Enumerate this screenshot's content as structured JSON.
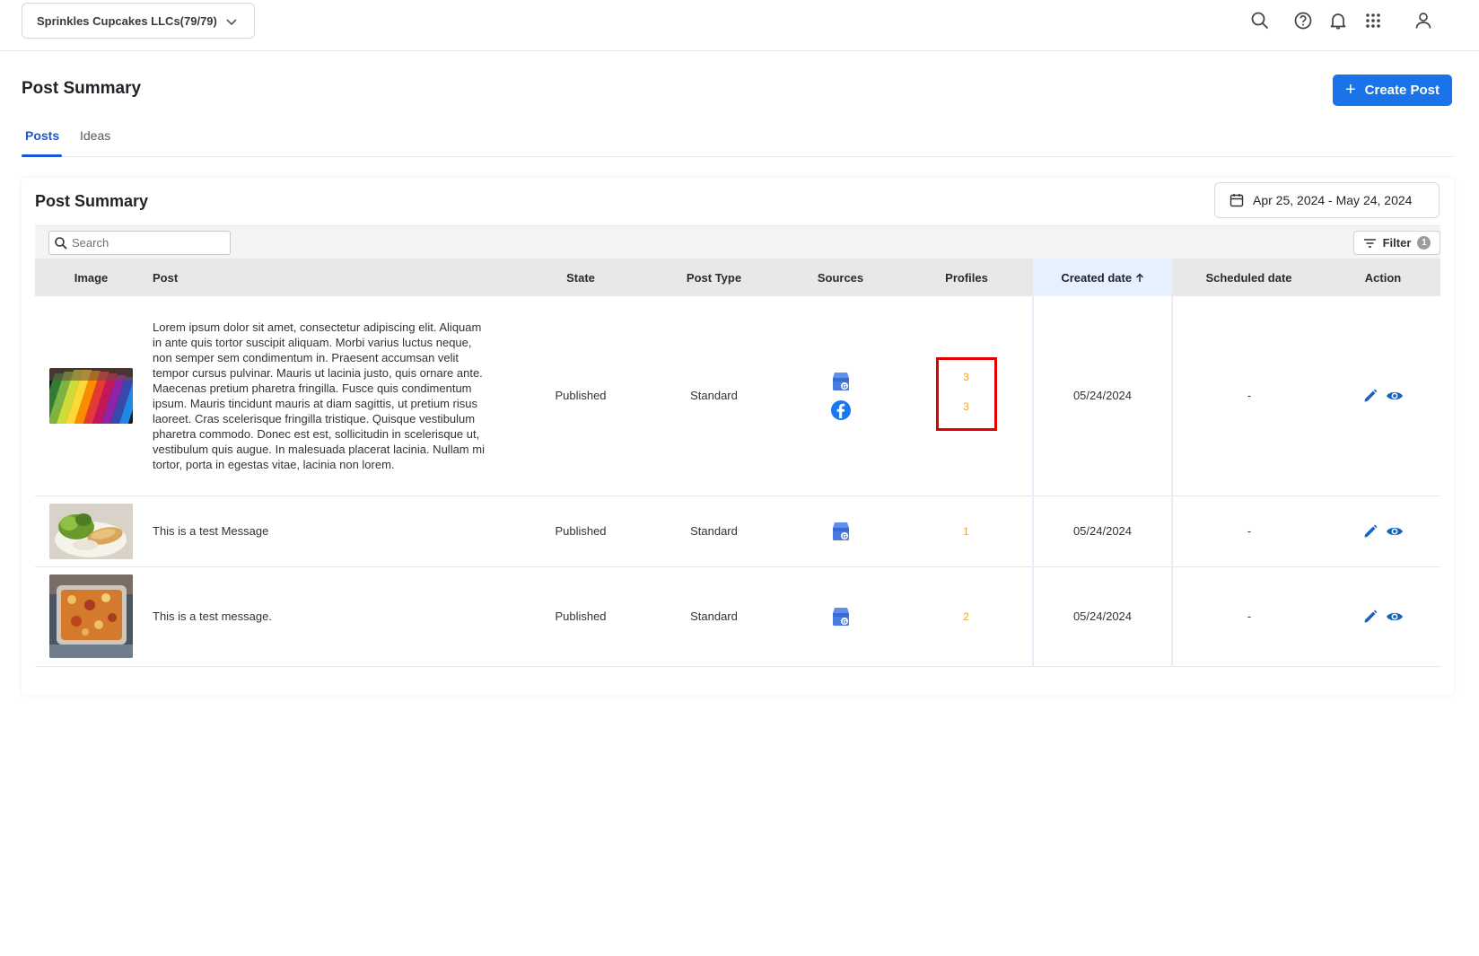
{
  "topbar": {
    "account_selector": "Sprinkles Cupcakes LLCs(79/79)",
    "icons": [
      "search-icon",
      "help-icon",
      "bell-icon",
      "apps-grid-icon",
      "user-icon"
    ]
  },
  "header": {
    "title": "Post Summary",
    "create_button": "Create Post"
  },
  "tabs": [
    {
      "label": "Posts",
      "active": true
    },
    {
      "label": "Ideas",
      "active": false
    }
  ],
  "summary": {
    "title": "Post Summary",
    "date_range": "Apr 25, 2024 - May 24, 2024",
    "search_placeholder": "Search",
    "filter_label": "Filter",
    "filter_count": "1"
  },
  "table": {
    "columns": [
      "Image",
      "Post",
      "State",
      "Post Type",
      "Sources",
      "Profiles",
      "Created date",
      "Scheduled date",
      "Action"
    ],
    "sorted_column": "Created date",
    "sort_direction": "ascending",
    "rows": [
      {
        "image": "colorful-crayons-photo",
        "post": "Lorem ipsum dolor sit amet, consectetur adipiscing elit. Aliquam in ante quis tortor suscipit aliquam. Morbi varius luctus neque, non semper sem condimentum in. Praesent accumsan velit tempor cursus pulvinar. Mauris ut lacinia justo, quis ornare ante. Maecenas pretium pharetra fringilla. Fusce quis condimentum ipsum. Mauris tincidunt mauris at diam sagittis, ut pretium risus laoreet. Cras scelerisque fringilla tristique. Quisque vestibulum pharetra commodo. Donec est est, sollicitudin in scelerisque ut, vestibulum quis augue. In malesuada placerat lacinia. Nullam mi tortor, porta in egestas vitae, lacinia non lorem.",
        "state": "Published",
        "post_type": "Standard",
        "sources": [
          "google-business-icon",
          "facebook-icon"
        ],
        "profiles": [
          "3",
          "3"
        ],
        "created_date": "05/24/2024",
        "scheduled_date": "-"
      },
      {
        "image": "salad-plate-photo",
        "post": "This is a test Message",
        "state": "Published",
        "post_type": "Standard",
        "sources": [
          "google-business-icon"
        ],
        "profiles": [
          "1"
        ],
        "created_date": "05/24/2024",
        "scheduled_date": "-"
      },
      {
        "image": "lasagna-dish-photo",
        "post": "This is a test message.",
        "state": "Published",
        "post_type": "Standard",
        "sources": [
          "google-business-icon"
        ],
        "profiles": [
          "2"
        ],
        "created_date": "05/24/2024",
        "scheduled_date": "-"
      }
    ]
  },
  "colors": {
    "primary": "#1a73e8",
    "profile_count": "#f5a623",
    "highlight": "#e00000"
  }
}
